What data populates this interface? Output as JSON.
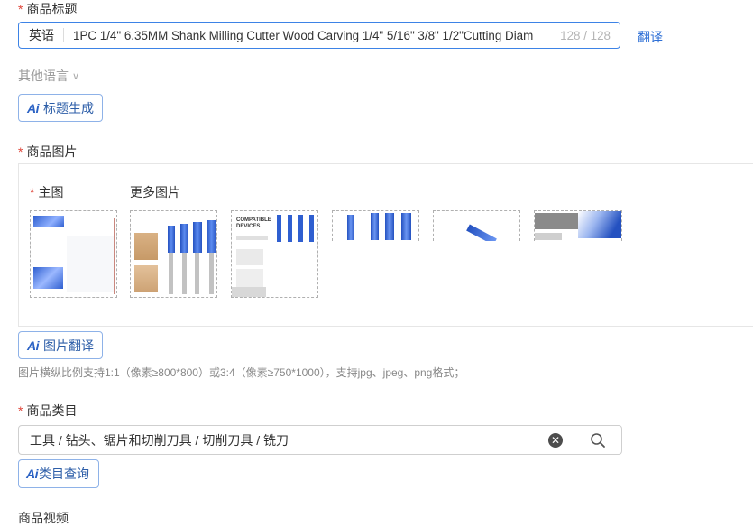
{
  "product_title": {
    "label": "商品标题",
    "language": "英语",
    "value": "1PC 1/4\" 6.35MM Shank Milling Cutter Wood Carving 1/4\" 5/16\" 3/8\" 1/2\"Cutting Diam",
    "counter": "128 / 128",
    "translate": "翻译",
    "other_languages": "其他语言",
    "ai_button": "标题生成"
  },
  "product_images": {
    "label": "商品图片",
    "main_label": "主图",
    "more_label": "更多图片",
    "thumb_text": "COMPATIBLE DEVICES",
    "ai_button": "图片翻译",
    "hint": "图片横纵比例支持1:1（像素≥800*800）或3:4（像素≥750*1000），支持jpg、jpeg、png格式；"
  },
  "category": {
    "label": "商品类目",
    "value": "工具 / 钻头、锯片和切削刀具 / 切削刀具 / 铣刀",
    "ai_button": "类目查询"
  },
  "video": {
    "label": "商品视频"
  },
  "ai_text": "Ai",
  "icons": {
    "clear": "clear-icon",
    "search": "search-icon",
    "chevron": "chevron-down-icon",
    "ai": "ai-icon"
  },
  "colors": {
    "accent": "#2d6fd6",
    "required": "#e0463a",
    "bit_blue": "#2f5fd0"
  }
}
